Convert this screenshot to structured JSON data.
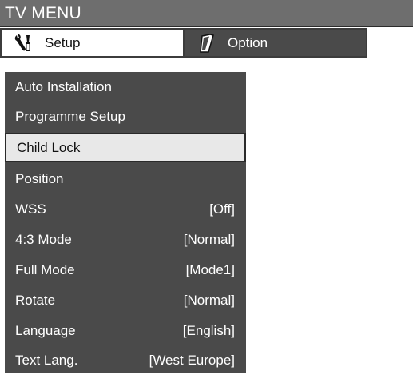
{
  "window": {
    "title": "TV MENU"
  },
  "tabs": [
    {
      "label": "Setup",
      "icon": "wrench-screwdriver-icon",
      "active": true
    },
    {
      "label": "Option",
      "icon": "remote-control-icon",
      "active": false
    }
  ],
  "menu": {
    "items": [
      {
        "label": "Auto Installation",
        "value": ""
      },
      {
        "label": "Programme Setup",
        "value": ""
      },
      {
        "label": "Child Lock",
        "value": "",
        "selected": true
      },
      {
        "label": "Position",
        "value": ""
      },
      {
        "label": "WSS",
        "value": "[Off]"
      },
      {
        "label": "4:3 Mode",
        "value": "[Normal]"
      },
      {
        "label": "Full Mode",
        "value": "[Mode1]"
      },
      {
        "label": "Rotate",
        "value": "[Normal]"
      },
      {
        "label": "Language",
        "value": "[English]"
      },
      {
        "label": "Text Lang.",
        "value": "[West Europe]"
      }
    ]
  },
  "colors": {
    "title_bar": "#6e6e6e",
    "menu_bg": "#4a4a4a",
    "selected_bg": "#e8e8e8",
    "active_tab_bg": "#ffffff"
  }
}
